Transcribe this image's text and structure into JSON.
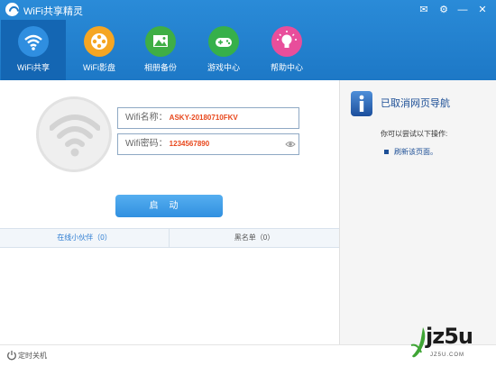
{
  "window": {
    "title": "WiFi共享精灵",
    "controls": {
      "mail": "✉",
      "settings": "⚙",
      "minimize": "—",
      "close": "✕"
    }
  },
  "nav": {
    "items": [
      {
        "label": "WiFi共享",
        "icon": "wifi-icon",
        "color": "#1466b3",
        "active": true
      },
      {
        "label": "WiFi影盘",
        "icon": "film-reel-icon",
        "color": "#f5a623"
      },
      {
        "label": "相册备份",
        "icon": "photo-icon",
        "color": "#3fae45"
      },
      {
        "label": "游戏中心",
        "icon": "gamepad-icon",
        "color": "#36b04a"
      },
      {
        "label": "帮助中心",
        "icon": "lightbulb-icon",
        "color": "#e84e9b"
      }
    ]
  },
  "share": {
    "name_label": "Wifi名称：",
    "name_value": "ASKY-20180710FKV",
    "password_label": "Wifi密码：",
    "password_value": "1234567890",
    "start_label": "启动"
  },
  "tabs": {
    "online": "在线小伙伴（0）",
    "blacklist": "黑名单（0）"
  },
  "side": {
    "title": "已取消网页导航",
    "subtitle": "你可以尝试以下操作:",
    "link": "刷新该页面。"
  },
  "bottom": {
    "timer_label": "定时关机"
  },
  "watermark": {
    "logo_text": "jz5u",
    "sub_text": "JZ5U.COM"
  },
  "colors": {
    "brand": "#1d78c6",
    "accent": "#e8471c",
    "link": "#1d4f96"
  }
}
